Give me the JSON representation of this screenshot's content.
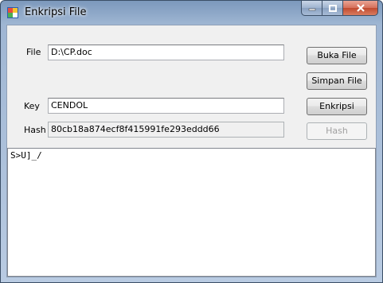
{
  "window": {
    "title": "Enkripsi File"
  },
  "form": {
    "file_label": "File",
    "file_value": "D:\\CP.doc",
    "key_label": "Key",
    "key_value": "CENDOL",
    "hash_label": "Hash",
    "hash_value": "80cb18a874ecf8f415991fe293eddd66"
  },
  "buttons": {
    "open_file": "Buka File",
    "save_file": "Simpan File",
    "encrypt": "Enkripsi",
    "hash": "Hash"
  },
  "output": {
    "text": "S>U]_/"
  }
}
